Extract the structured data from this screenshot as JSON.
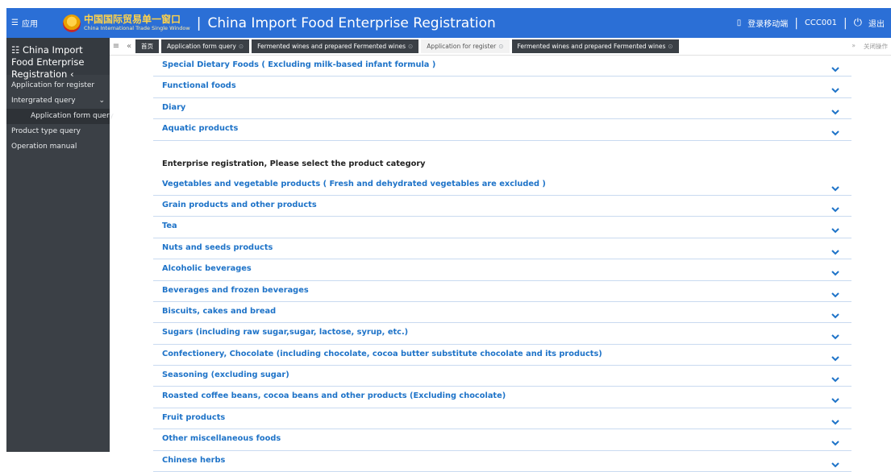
{
  "header": {
    "menu_label": "应用",
    "logo_cn": "中国国际贸易单一窗口",
    "logo_en": "China International Trade Single Window",
    "title": "China Import Food Enterprise Registration",
    "mobile_login": "登录移动端",
    "user": "CCC001",
    "logout": "退出"
  },
  "sidebar": {
    "title": "China Import Food Enterprise Registration",
    "items": [
      "Application for register",
      "Intergrated query",
      "Application form query",
      "Product type query",
      "Operation manual"
    ]
  },
  "tabs": {
    "home": "首页",
    "items": [
      "Application form query",
      "Fermented wines and prepared Fermented wines",
      "Application for register",
      "Fermented wines and prepared Fermented wines"
    ],
    "close_ops": "关闭操作"
  },
  "top_categories": [
    "Special Dietary Foods ( Excluding milk-based infant formula )",
    "Functional foods",
    "Diary",
    "Aquatic products"
  ],
  "section_title": "Enterprise registration, Please select the product category",
  "categories": [
    "Vegetables and vegetable products ( Fresh and dehydrated vegetables are excluded )",
    "Grain products and other products",
    "Tea",
    "Nuts and seeds products",
    "Alcoholic beverages",
    "Beverages and frozen beverages",
    "Biscuits, cakes and bread",
    "Sugars (including raw sugar,sugar, lactose, syrup, etc.)",
    "Confectionery, Chocolate (including chocolate, cocoa butter substitute chocolate and its products)",
    "Seasoning (excluding sugar)",
    "Roasted coffee beans, cocoa beans and other products (Excluding chocolate)",
    "Fruit products",
    "Other miscellaneous foods",
    "Chinese herbs"
  ],
  "colors": {
    "header_bg": "#2b6fd6",
    "sidebar_bg": "#3b4046",
    "link": "#1e73c8",
    "row_border": "#c9daf0"
  }
}
